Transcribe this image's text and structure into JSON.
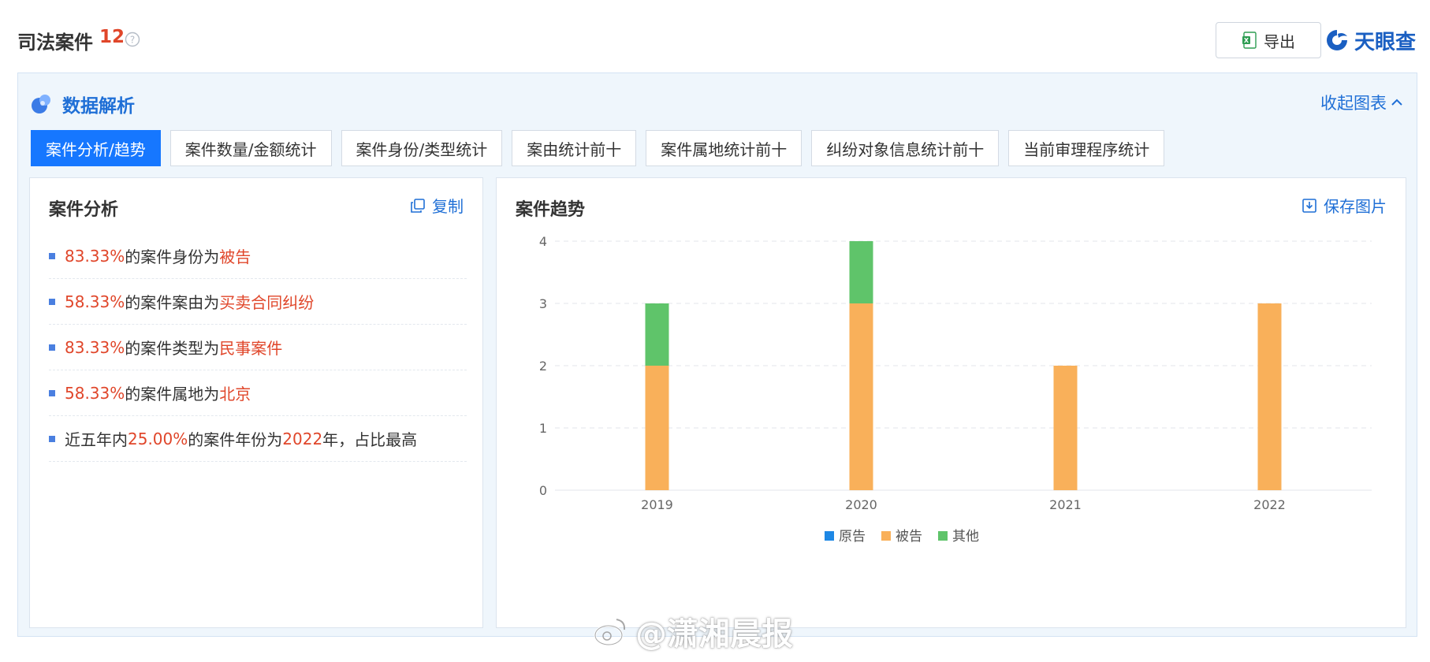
{
  "header": {
    "title": "司法案件",
    "count": "12",
    "export_label": "导出",
    "brand_text": "天眼查"
  },
  "panel": {
    "title": "数据解析",
    "collapse_label": "收起图表"
  },
  "tabs": [
    {
      "label": "案件分析/趋势",
      "active": true
    },
    {
      "label": "案件数量/金额统计",
      "active": false
    },
    {
      "label": "案件身份/类型统计",
      "active": false
    },
    {
      "label": "案由统计前十",
      "active": false
    },
    {
      "label": "案件属地统计前十",
      "active": false
    },
    {
      "label": "纠纷对象信息统计前十",
      "active": false
    },
    {
      "label": "当前审理程序统计",
      "active": false
    }
  ],
  "analysis": {
    "title": "案件分析",
    "copy_label": "复制",
    "items": [
      {
        "p1": "83.33%",
        "p2": "的案件身份为",
        "p3": "被告",
        "p4": "",
        "p5": ""
      },
      {
        "p1": "58.33%",
        "p2": "的案件案由为",
        "p3": "买卖合同纠纷",
        "p4": "",
        "p5": ""
      },
      {
        "p1": "83.33%",
        "p2": "的案件类型为",
        "p3": "民事案件",
        "p4": "",
        "p5": ""
      },
      {
        "p1": "58.33%",
        "p2": "的案件属地为",
        "p3": "北京",
        "p4": "",
        "p5": ""
      }
    ],
    "last_item": {
      "pre": "近五年内",
      "pct": "25.00%",
      "mid": "的案件年份为",
      "year": "2022",
      "post": "年，占比最高"
    }
  },
  "trend": {
    "title": "案件趋势",
    "save_label": "保存图片"
  },
  "chart_data": {
    "type": "bar",
    "stacked": true,
    "categories": [
      "2019",
      "2020",
      "2021",
      "2022"
    ],
    "series": [
      {
        "name": "原告",
        "color": "#1e88e5",
        "values": [
          0,
          0,
          0,
          0
        ]
      },
      {
        "name": "被告",
        "color": "#f9b05a",
        "values": [
          2,
          3,
          2,
          3
        ]
      },
      {
        "name": "其他",
        "color": "#5fc46a",
        "values": [
          1,
          1,
          0,
          0
        ]
      }
    ],
    "yticks": [
      0,
      1,
      2,
      3,
      4
    ],
    "ylim": [
      0,
      4
    ],
    "grid": true,
    "legend_position": "bottom"
  },
  "watermark": {
    "text": "@潇湘晨报"
  },
  "colors": {
    "accent": "#1677ff",
    "highlight": "#e0462a",
    "link": "#1f6fd6"
  }
}
